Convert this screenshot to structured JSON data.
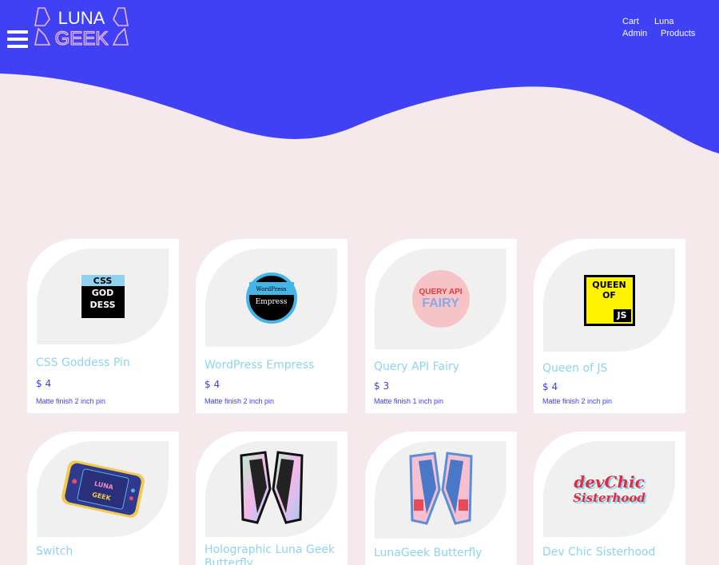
{
  "header": {
    "logo_top": "LUNA",
    "logo_bottom": "GEEK",
    "nav": [
      "Cart",
      "Luna",
      "Admin",
      "Products"
    ]
  },
  "colors": {
    "header_bg": "#4040f5",
    "page_bg": "#f6e9ec",
    "card_bg": "#ffffff",
    "title": "#8ed3ef",
    "price": "#3d3df0"
  },
  "products": [
    {
      "title": "CSS Goddess Pin",
      "price": "$ 4",
      "desc": "Matte finish 2 inch pin",
      "art": [
        "CSS",
        "GOD",
        "DESS"
      ]
    },
    {
      "title": "WordPress Empress",
      "price": "$ 4",
      "desc": "Matte finish 2 inch pin",
      "art": [
        "WordPress",
        "Empress"
      ]
    },
    {
      "title": "Query API Fairy",
      "price": "$ 3",
      "desc": "Matte finish 1 inch pin",
      "art": [
        "QUERY API",
        "FAIRY"
      ]
    },
    {
      "title": "Queen of JS",
      "price": "$ 4",
      "desc": "Matte finish 2 inch pin",
      "art": [
        "QUEEN",
        "OF",
        "JS"
      ]
    },
    {
      "title": "Switch",
      "price": "",
      "desc": "",
      "art": [
        "LUNA",
        "GEEK"
      ]
    },
    {
      "title": "Holographic Luna Geek Butterfly",
      "price": "",
      "desc": "",
      "art": []
    },
    {
      "title": "LunaGeek Butterfly",
      "price": "",
      "desc": "",
      "art": []
    },
    {
      "title": "Dev Chic Sisterhood",
      "price": "",
      "desc": "",
      "art": [
        "devChic",
        "Sisterhood"
      ]
    }
  ]
}
